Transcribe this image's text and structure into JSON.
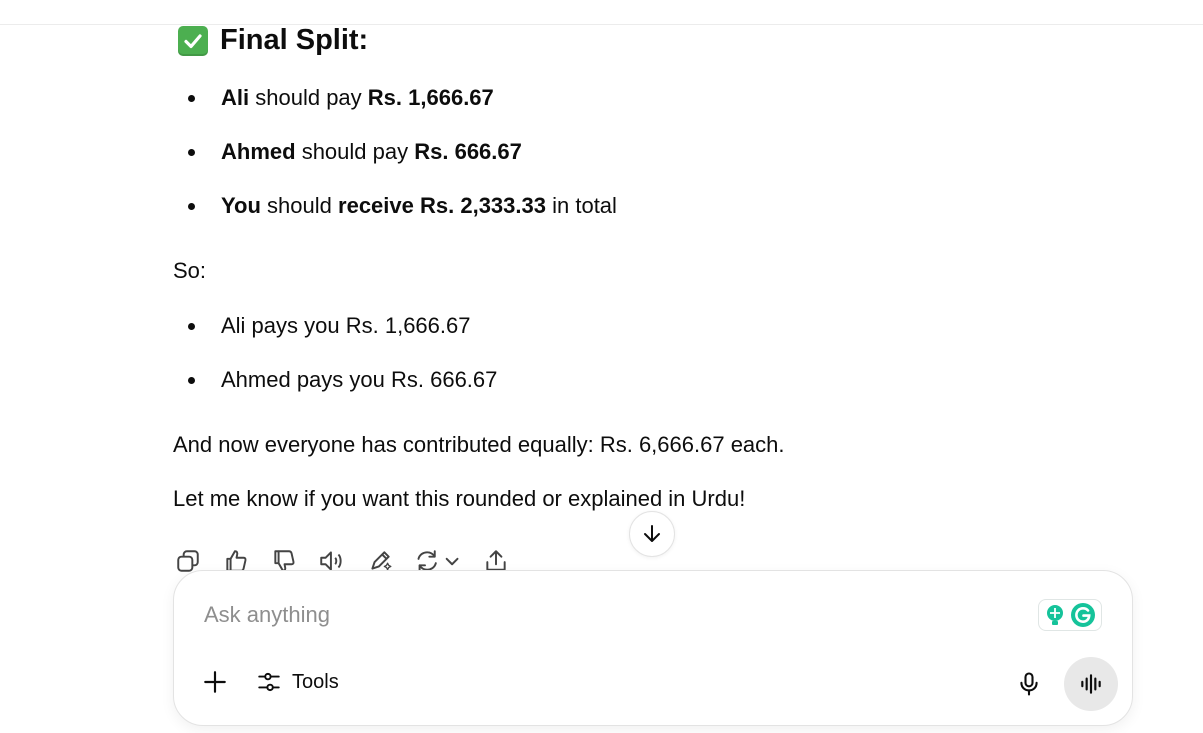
{
  "heading": {
    "text": "Final Split:"
  },
  "split_items": [
    {
      "name": "Ali",
      "verb": "should pay",
      "amount": "Rs. 1,666.67"
    },
    {
      "name": "Ahmed",
      "verb": "should pay",
      "amount": "Rs. 666.67"
    },
    {
      "name": "You",
      "pre": "should",
      "verb": "receive",
      "amount": "Rs. 2,333.33",
      "suffix": "in total"
    }
  ],
  "so_label": "So:",
  "payments": [
    "Ali pays you Rs. 1,666.67",
    "Ahmed pays you Rs. 666.67"
  ],
  "summary": "And now everyone has contributed equally: Rs. 6,666.67 each.",
  "closing": "Let me know if you want this rounded or explained in Urdu!",
  "composer": {
    "placeholder": "Ask anything",
    "tools_label": "Tools"
  },
  "icons": {
    "heading": "check-mark-button-icon",
    "scroll": "arrow-down-icon",
    "actions": [
      "copy-icon",
      "thumbs-up-icon",
      "thumbs-down-icon",
      "read-aloud-icon",
      "edit-icon",
      "regenerate-icon",
      "share-icon"
    ],
    "composer": [
      "plus-icon",
      "tools-sliders-icon",
      "microphone-icon",
      "voice-mode-icon",
      "grammarly-icon"
    ]
  },
  "colors": {
    "check_green": "#4caf50",
    "grammarly_green": "#15c39a"
  }
}
